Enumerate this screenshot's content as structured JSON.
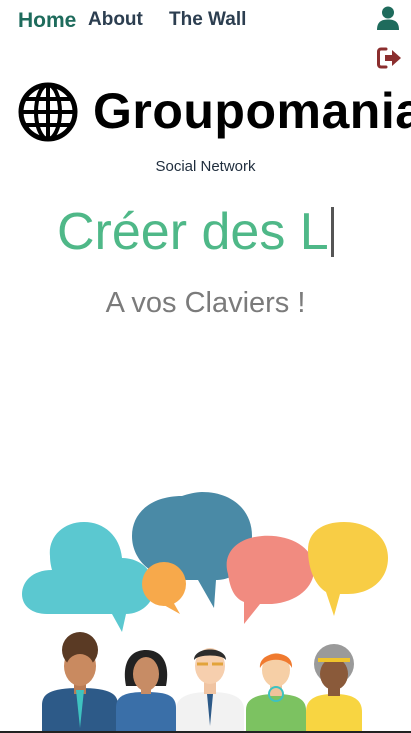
{
  "nav": {
    "home_label": "Home",
    "about_label": "About",
    "wall_label": "The Wall",
    "user_icon": "user-icon",
    "logout_icon": "logout-icon"
  },
  "brand": {
    "name": "Groupomania",
    "subtitle": "Social Network",
    "logo_icon": "globe-icon"
  },
  "hero": {
    "typing_text": "Créer des L",
    "tagline": "A vos Claviers !"
  },
  "colors": {
    "primary_green": "#4fb888",
    "nav_active": "#1e6b5c",
    "logout_red": "#8b2e2e"
  }
}
